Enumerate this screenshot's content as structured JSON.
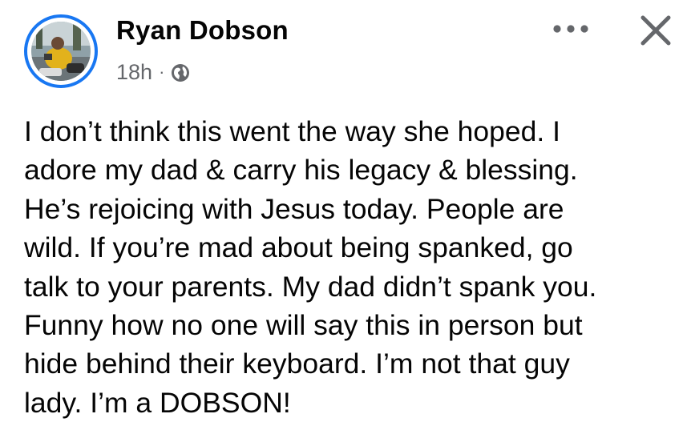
{
  "post": {
    "author": "Ryan Dobson",
    "time": "18h",
    "separator": "·",
    "audience_icon": "globe-icon",
    "more_icon": "more-options-icon",
    "close_icon": "close-icon",
    "text_lines": [
      "I don’t think this went the way she hoped. I",
      "adore my dad & carry his legacy & blessing.",
      "He’s rejoicing with Jesus today. People are",
      "wild. If you’re mad about being spanked, go",
      "talk to your parents. My dad didn’t spank you.",
      "Funny how no one will say this in person but",
      "hide behind their keyboard. I’m not that guy",
      "lady. I’m a DOBSON!"
    ]
  },
  "colors": {
    "avatar_ring": "#1877f2",
    "meta_text": "#65676b",
    "icon": "#65676b",
    "text": "#050505"
  }
}
